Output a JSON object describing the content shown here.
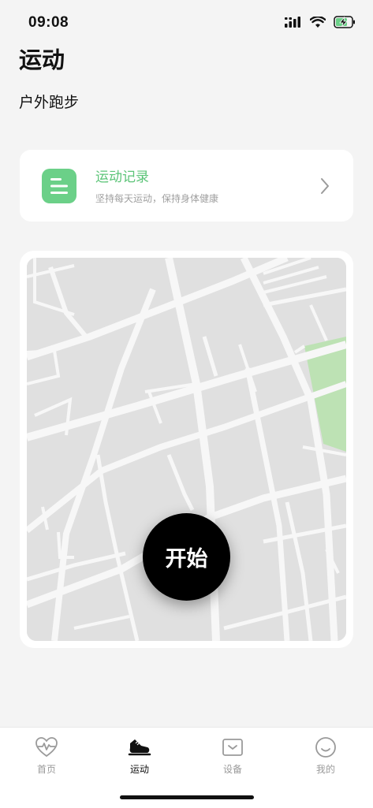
{
  "status_bar": {
    "time": "09:08"
  },
  "header": {
    "title": "运动",
    "subtitle": "户外跑步"
  },
  "record_card": {
    "title": "运动记录",
    "description": "坚持每天运动，保持身体健康",
    "icon": "list-icon"
  },
  "map": {
    "start_label": "开始"
  },
  "tabs": [
    {
      "label": "首页",
      "icon": "heart-pulse-icon"
    },
    {
      "label": "运动",
      "icon": "sneaker-icon"
    },
    {
      "label": "设备",
      "icon": "device-icon"
    },
    {
      "label": "我的",
      "icon": "smiley-icon"
    }
  ],
  "colors": {
    "accent_green": "#5cc478",
    "icon_green": "#6bd088",
    "park_green": "#bde2b4",
    "map_bg": "#e0e0e0",
    "road": "#f7f7f7"
  }
}
